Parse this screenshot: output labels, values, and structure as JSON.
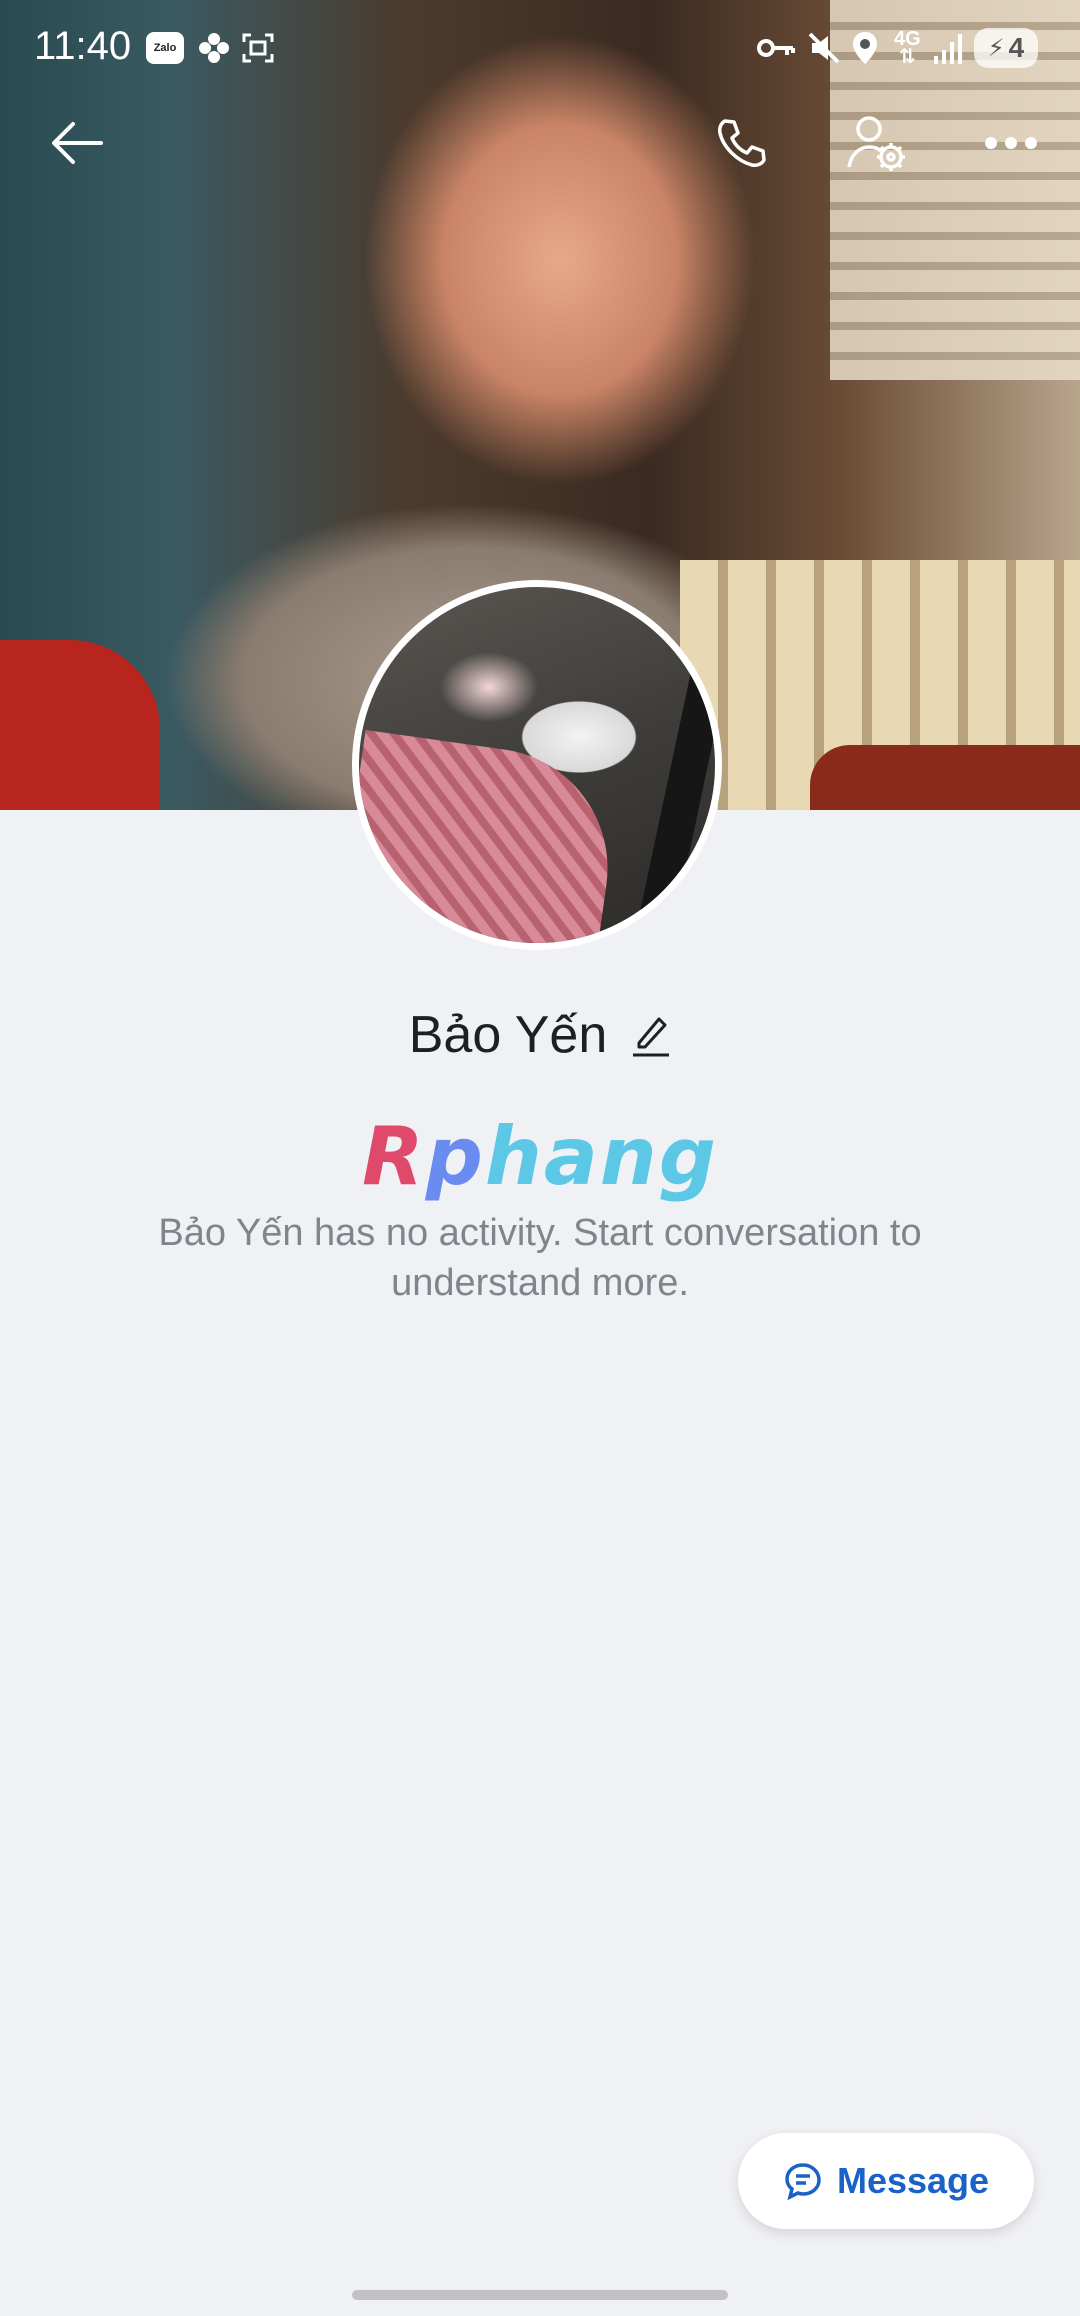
{
  "status_bar": {
    "time": "11:40",
    "app_badge": "Zalo",
    "network": "4G",
    "battery": "4"
  },
  "profile": {
    "name": "Bảo Yến",
    "logo_text_r": "R",
    "logo_text_p": "p",
    "logo_text_rest": "hang",
    "activity_text": "Bảo Yến has no activity. Start conversation to understand more."
  },
  "actions": {
    "message_label": "Message"
  },
  "icons": {
    "back": "back-arrow-icon",
    "call": "phone-icon",
    "profile_settings": "user-settings-icon",
    "more": "more-icon",
    "edit": "pencil-icon",
    "message": "chat-bubble-icon"
  },
  "colors": {
    "accent": "#1a61c8",
    "background": "#f0f1f5",
    "secondary_text": "#80858c"
  }
}
